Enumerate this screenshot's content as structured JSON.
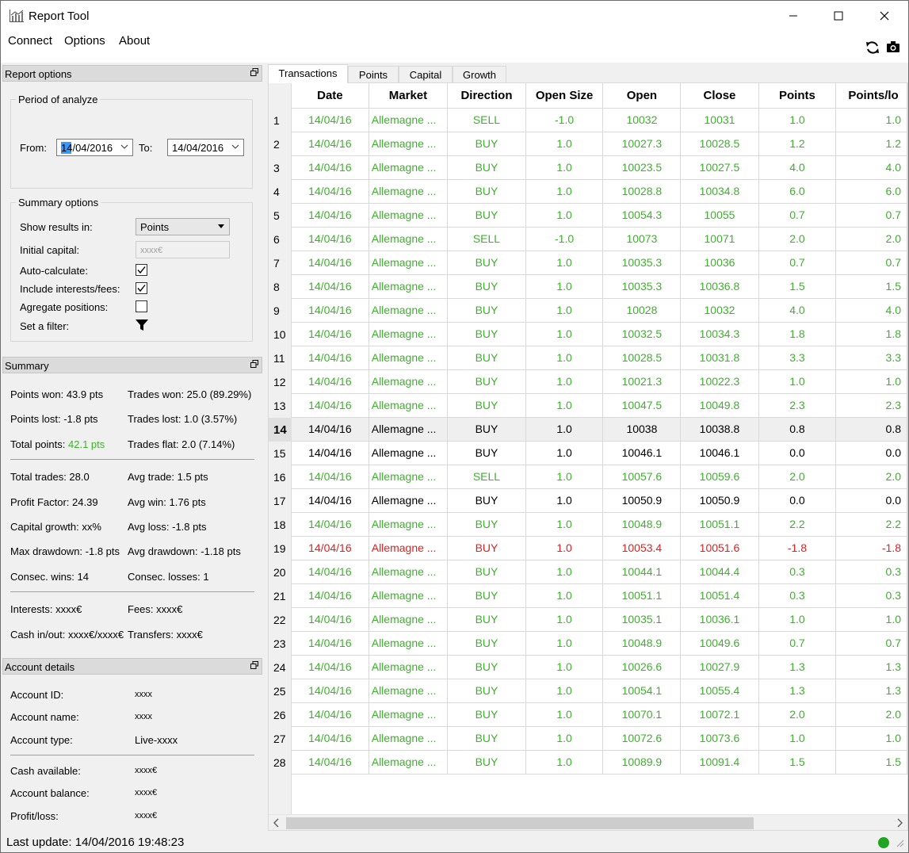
{
  "window": {
    "title": "Report Tool",
    "icon": "chart-app-icon"
  },
  "menu": {
    "connect": "Connect",
    "options": "Options",
    "about": "About"
  },
  "report_options": {
    "title": "Report options",
    "period_group": "Period of analyze",
    "from_label": "From:",
    "from_value": "14/04/2016",
    "to_label": "To:",
    "to_value": "14/04/2016",
    "summary_group": "Summary options",
    "show_results_label": "Show results in:",
    "show_results_value": "Points",
    "initial_capital_label": "Initial capital:",
    "initial_capital_placeholder": "xxxx€",
    "auto_calculate_label": "Auto-calculate:",
    "auto_calculate_checked": true,
    "include_interests_label": "Include interests/fees:",
    "include_interests_checked": true,
    "aggregate_label": "Agregate positions:",
    "aggregate_checked": false,
    "filter_label": "Set a filter:"
  },
  "summary": {
    "title": "Summary",
    "points_won": "Points won: 43.9 pts",
    "trades_won": "Trades won: 25.0 (89.29%)",
    "points_lost": "Points lost: -1.8 pts",
    "trades_lost": "Trades lost: 1.0 (3.57%)",
    "total_points_label": "Total points:",
    "total_points_value": "42.1 pts",
    "trades_flat": "Trades flat: 2.0 (7.14%)",
    "total_trades": "Total trades: 28.0",
    "avg_trade": "Avg trade: 1.5 pts",
    "profit_factor": "Profit Factor: 24.39",
    "avg_win": "Avg win: 1.76 pts",
    "capital_growth": "Capital growth: xx%",
    "avg_loss": "Avg loss: -1.8 pts",
    "max_drawdown": "Max drawdown: -1.8 pts",
    "avg_drawdown": "Avg drawdown: -1.18 pts",
    "consec_wins": "Consec. wins: 14",
    "consec_losses": "Consec. losses: 1",
    "interests": "Interests: xxxx€",
    "fees": "Fees: xxxx€",
    "cash_inout": "Cash in/out: xxxx€/xxxx€",
    "transfers": "Transfers: xxxx€"
  },
  "account": {
    "title": "Account details",
    "id_label": "Account ID:",
    "id_value": "xxxx",
    "name_label": "Account name:",
    "name_value": "xxxx",
    "type_label": "Account type:",
    "type_value": "Live-xxxx",
    "cash_label": "Cash available:",
    "cash_value": "xxxx€",
    "balance_label": "Account balance:",
    "balance_value": "xxxx€",
    "pl_label": "Profit/loss:",
    "pl_value": "xxxx€"
  },
  "tabs": [
    "Transactions",
    "Points",
    "Capital",
    "Growth"
  ],
  "table": {
    "columns": [
      "Date",
      "Market",
      "Direction",
      "Open Size",
      "Open",
      "Close",
      "Points",
      "Points/lo"
    ],
    "selected_row": 14,
    "rows": [
      {
        "n": "1",
        "date": "14/04/16",
        "market": "Allemagne ...",
        "dir": "SELL",
        "size": "-1.0",
        "open": "10032",
        "close": "10031",
        "points": "1.0",
        "plo": "1.0",
        "status": "green"
      },
      {
        "n": "2",
        "date": "14/04/16",
        "market": "Allemagne ...",
        "dir": "BUY",
        "size": "1.0",
        "open": "10027.3",
        "close": "10028.5",
        "points": "1.2",
        "plo": "1.2",
        "status": "green"
      },
      {
        "n": "3",
        "date": "14/04/16",
        "market": "Allemagne ...",
        "dir": "BUY",
        "size": "1.0",
        "open": "10023.5",
        "close": "10027.5",
        "points": "4.0",
        "plo": "4.0",
        "status": "green"
      },
      {
        "n": "4",
        "date": "14/04/16",
        "market": "Allemagne ...",
        "dir": "BUY",
        "size": "1.0",
        "open": "10028.8",
        "close": "10034.8",
        "points": "6.0",
        "plo": "6.0",
        "status": "green"
      },
      {
        "n": "5",
        "date": "14/04/16",
        "market": "Allemagne ...",
        "dir": "BUY",
        "size": "1.0",
        "open": "10054.3",
        "close": "10055",
        "points": "0.7",
        "plo": "0.7",
        "status": "green"
      },
      {
        "n": "6",
        "date": "14/04/16",
        "market": "Allemagne ...",
        "dir": "SELL",
        "size": "-1.0",
        "open": "10073",
        "close": "10071",
        "points": "2.0",
        "plo": "2.0",
        "status": "green"
      },
      {
        "n": "7",
        "date": "14/04/16",
        "market": "Allemagne ...",
        "dir": "BUY",
        "size": "1.0",
        "open": "10035.3",
        "close": "10036",
        "points": "0.7",
        "plo": "0.7",
        "status": "green"
      },
      {
        "n": "8",
        "date": "14/04/16",
        "market": "Allemagne ...",
        "dir": "BUY",
        "size": "1.0",
        "open": "10035.3",
        "close": "10036.8",
        "points": "1.5",
        "plo": "1.5",
        "status": "green"
      },
      {
        "n": "9",
        "date": "14/04/16",
        "market": "Allemagne ...",
        "dir": "BUY",
        "size": "1.0",
        "open": "10028",
        "close": "10032",
        "points": "4.0",
        "plo": "4.0",
        "status": "green"
      },
      {
        "n": "10",
        "date": "14/04/16",
        "market": "Allemagne ...",
        "dir": "BUY",
        "size": "1.0",
        "open": "10032.5",
        "close": "10034.3",
        "points": "1.8",
        "plo": "1.8",
        "status": "green"
      },
      {
        "n": "11",
        "date": "14/04/16",
        "market": "Allemagne ...",
        "dir": "BUY",
        "size": "1.0",
        "open": "10028.5",
        "close": "10031.8",
        "points": "3.3",
        "plo": "3.3",
        "status": "green"
      },
      {
        "n": "12",
        "date": "14/04/16",
        "market": "Allemagne ...",
        "dir": "BUY",
        "size": "1.0",
        "open": "10021.3",
        "close": "10022.3",
        "points": "1.0",
        "plo": "1.0",
        "status": "green"
      },
      {
        "n": "13",
        "date": "14/04/16",
        "market": "Allemagne ...",
        "dir": "BUY",
        "size": "1.0",
        "open": "10047.5",
        "close": "10049.8",
        "points": "2.3",
        "plo": "2.3",
        "status": "green"
      },
      {
        "n": "14",
        "date": "14/04/16",
        "market": "Allemagne ...",
        "dir": "BUY",
        "size": "1.0",
        "open": "10038",
        "close": "10038.8",
        "points": "0.8",
        "plo": "0.8",
        "status": "black"
      },
      {
        "n": "15",
        "date": "14/04/16",
        "market": "Allemagne ...",
        "dir": "BUY",
        "size": "1.0",
        "open": "10046.1",
        "close": "10046.1",
        "points": "0.0",
        "plo": "0.0",
        "status": "black"
      },
      {
        "n": "16",
        "date": "14/04/16",
        "market": "Allemagne ...",
        "dir": "SELL",
        "size": "1.0",
        "open": "10057.6",
        "close": "10059.6",
        "points": "2.0",
        "plo": "2.0",
        "status": "green"
      },
      {
        "n": "17",
        "date": "14/04/16",
        "market": "Allemagne ...",
        "dir": "BUY",
        "size": "1.0",
        "open": "10050.9",
        "close": "10050.9",
        "points": "0.0",
        "plo": "0.0",
        "status": "black"
      },
      {
        "n": "18",
        "date": "14/04/16",
        "market": "Allemagne ...",
        "dir": "BUY",
        "size": "1.0",
        "open": "10048.9",
        "close": "10051.1",
        "points": "2.2",
        "plo": "2.2",
        "status": "green"
      },
      {
        "n": "19",
        "date": "14/04/16",
        "market": "Allemagne ...",
        "dir": "BUY",
        "size": "1.0",
        "open": "10053.4",
        "close": "10051.6",
        "points": "-1.8",
        "plo": "-1.8",
        "status": "red"
      },
      {
        "n": "20",
        "date": "14/04/16",
        "market": "Allemagne ...",
        "dir": "BUY",
        "size": "1.0",
        "open": "10044.1",
        "close": "10044.4",
        "points": "0.3",
        "plo": "0.3",
        "status": "green"
      },
      {
        "n": "21",
        "date": "14/04/16",
        "market": "Allemagne ...",
        "dir": "BUY",
        "size": "1.0",
        "open": "10051.1",
        "close": "10051.4",
        "points": "0.3",
        "plo": "0.3",
        "status": "green"
      },
      {
        "n": "22",
        "date": "14/04/16",
        "market": "Allemagne ...",
        "dir": "BUY",
        "size": "1.0",
        "open": "10035.1",
        "close": "10036.1",
        "points": "1.0",
        "plo": "1.0",
        "status": "green"
      },
      {
        "n": "23",
        "date": "14/04/16",
        "market": "Allemagne ...",
        "dir": "BUY",
        "size": "1.0",
        "open": "10048.9",
        "close": "10049.6",
        "points": "0.7",
        "plo": "0.7",
        "status": "green"
      },
      {
        "n": "24",
        "date": "14/04/16",
        "market": "Allemagne ...",
        "dir": "BUY",
        "size": "1.0",
        "open": "10026.6",
        "close": "10027.9",
        "points": "1.3",
        "plo": "1.3",
        "status": "green"
      },
      {
        "n": "25",
        "date": "14/04/16",
        "market": "Allemagne ...",
        "dir": "BUY",
        "size": "1.0",
        "open": "10054.1",
        "close": "10055.4",
        "points": "1.3",
        "plo": "1.3",
        "status": "green"
      },
      {
        "n": "26",
        "date": "14/04/16",
        "market": "Allemagne ...",
        "dir": "BUY",
        "size": "1.0",
        "open": "10070.1",
        "close": "10072.1",
        "points": "2.0",
        "plo": "2.0",
        "status": "green"
      },
      {
        "n": "27",
        "date": "14/04/16",
        "market": "Allemagne ...",
        "dir": "BUY",
        "size": "1.0",
        "open": "10072.6",
        "close": "10073.6",
        "points": "1.0",
        "plo": "1.0",
        "status": "green"
      },
      {
        "n": "28",
        "date": "14/04/16",
        "market": "Allemagne ...",
        "dir": "BUY",
        "size": "1.0",
        "open": "10089.9",
        "close": "10091.4",
        "points": "1.5",
        "plo": "1.5",
        "status": "green"
      }
    ]
  },
  "status": {
    "text": "Last update: 14/04/2016 19:48:23",
    "connection_color": "#1fa51f"
  },
  "colors": {
    "profit": "#3cb22a",
    "loss": "#e02020",
    "neutral": "#000000"
  }
}
